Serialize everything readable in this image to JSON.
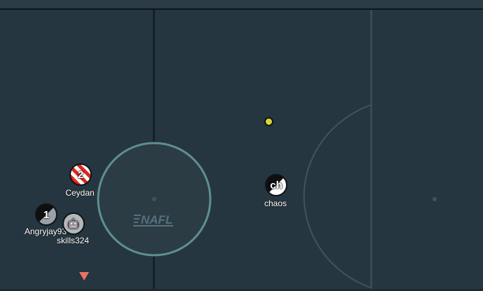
{
  "game": {
    "stadium_logo_text": "NAFL",
    "colors": {
      "field": "#263640",
      "line": "#0e1519",
      "soft_line": "#3f5a65",
      "center_ring": "#5f8f92",
      "ball": "#d9d82f",
      "marker": "#e87463",
      "red_team": "#e0241e"
    }
  },
  "players": [
    {
      "id": "ceydan",
      "name": "Ceydan",
      "avatar": "2",
      "style": "stripe-red",
      "icon": "red-striped-disc"
    },
    {
      "id": "angryjay",
      "name": "Angryjay93",
      "avatar": "1",
      "style": "split-grey",
      "icon": "black-grey-disc"
    },
    {
      "id": "skills",
      "name": "skills324",
      "avatar": "🤖",
      "style": "plain-grey",
      "icon": "robot-face"
    },
    {
      "id": "chaos",
      "name": "chaos",
      "avatar": "ch",
      "style": "split-white",
      "icon": "black-white-disc"
    }
  ]
}
